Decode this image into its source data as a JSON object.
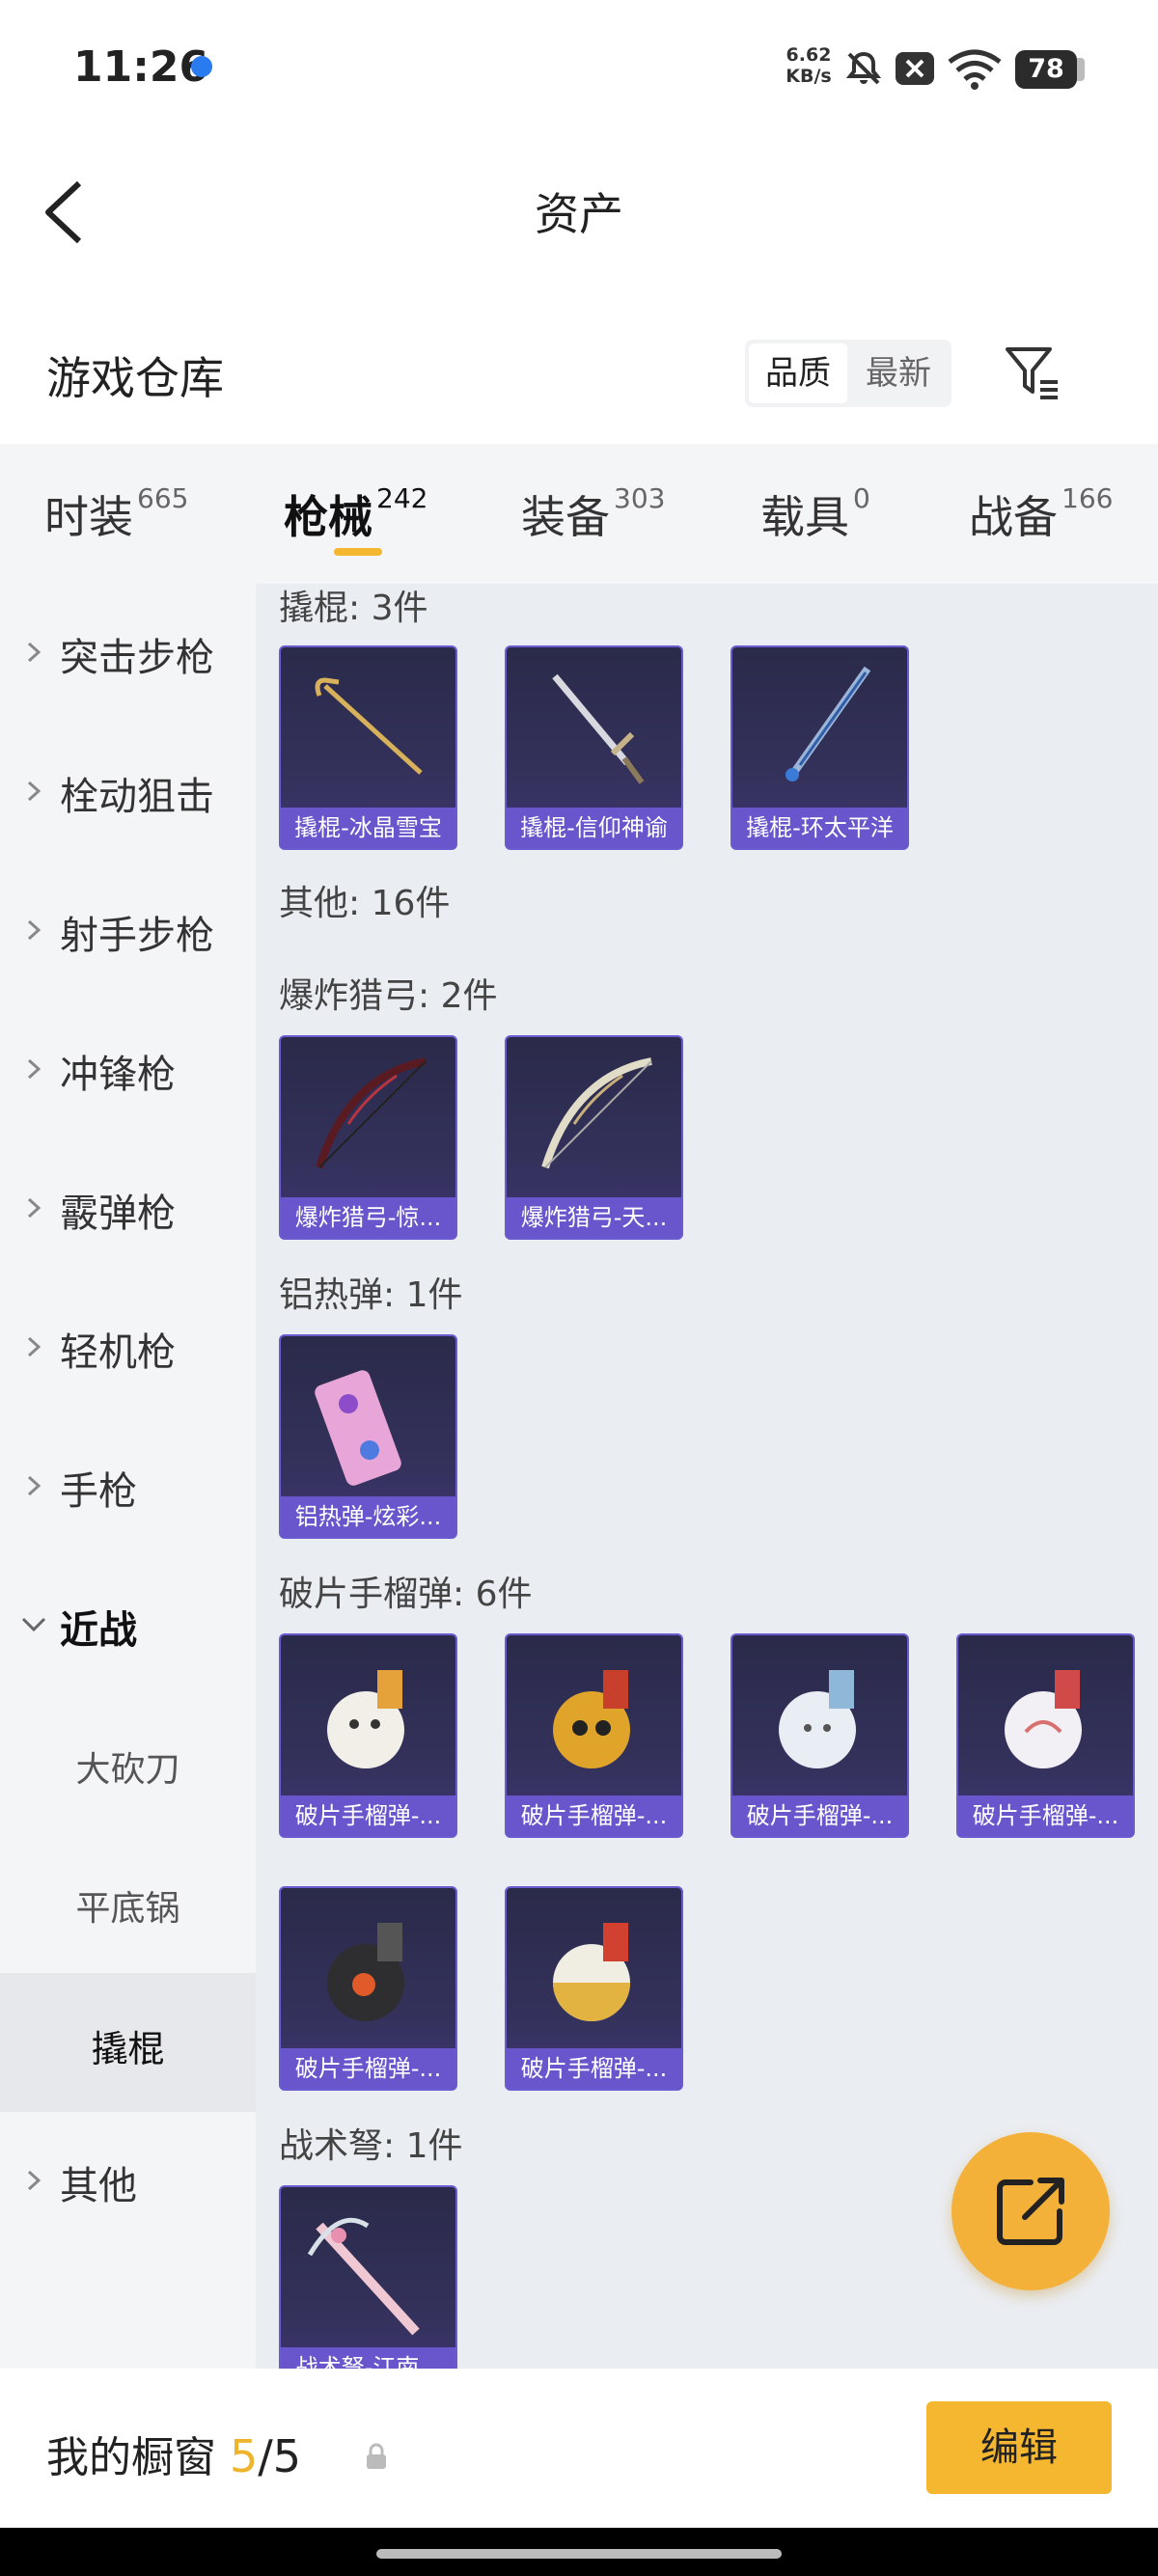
{
  "status_bar": {
    "time": "11:26",
    "net_speed_value": "6.62",
    "net_speed_unit": "KB/s",
    "battery": "78",
    "icons": [
      "app-notification-icon",
      "mute-icon",
      "x-box-icon",
      "wifi-icon",
      "battery-icon"
    ]
  },
  "header": {
    "title": "资产",
    "back_icon": "chevron-left-icon"
  },
  "section": {
    "title": "游戏仓库",
    "sort_active": "品质",
    "sort_inactive": "最新",
    "filter_icon": "filter-icon"
  },
  "tabs": [
    {
      "label": "时装",
      "count": "665"
    },
    {
      "label": "枪械",
      "count": "242",
      "active": true
    },
    {
      "label": "装备",
      "count": "303"
    },
    {
      "label": "载具",
      "count": "0"
    },
    {
      "label": "战备",
      "count": "166"
    }
  ],
  "sidebar": {
    "items": [
      {
        "label": "突击步枪"
      },
      {
        "label": "栓动狙击"
      },
      {
        "label": "射手步枪"
      },
      {
        "label": "冲锋枪"
      },
      {
        "label": "霰弹枪"
      },
      {
        "label": "轻机枪"
      },
      {
        "label": "手枪"
      },
      {
        "label": "近战",
        "open": true
      },
      {
        "label": "其他"
      }
    ],
    "sub_items": [
      {
        "label": "大砍刀"
      },
      {
        "label": "平底锅"
      },
      {
        "label": "撬棍",
        "selected": true
      }
    ]
  },
  "content": {
    "groups": [
      {
        "label": "撬棍: 3件",
        "items": [
          "撬棍-冰晶雪宝",
          "撬棍-信仰神谕",
          "撬棍-环太平洋"
        ]
      },
      {
        "label": "其他: 16件",
        "items": []
      },
      {
        "label": "爆炸猎弓: 2件",
        "items": [
          "爆炸猎弓-惊...",
          "爆炸猎弓-天..."
        ]
      },
      {
        "label": "铝热弹: 1件",
        "items": [
          "铝热弹-炫彩..."
        ]
      },
      {
        "label": "破片手榴弹: 6件",
        "items": [
          "破片手榴弹-...",
          "破片手榴弹-...",
          "破片手榴弹-...",
          "破片手榴弹-...",
          "破片手榴弹-...",
          "破片手榴弹-..."
        ]
      },
      {
        "label": "战术弩: 1件",
        "items": [
          "战术弩-江南..."
        ]
      }
    ]
  },
  "fab": {
    "icon": "share-external-icon"
  },
  "bottom_bar": {
    "label": "我的橱窗",
    "used": "5",
    "sep": "/",
    "total": "5",
    "lock_icon": "lock-icon",
    "edit_label": "编辑"
  },
  "colors": {
    "accent": "#f5b730",
    "card_label_bg": "#6a56cc",
    "content_bg": "#eaedf2",
    "sidebar_bg": "#f4f5f7"
  }
}
